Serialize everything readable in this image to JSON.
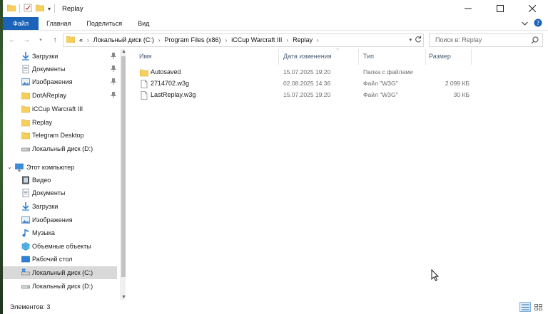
{
  "window": {
    "title": "Replay"
  },
  "ribbon": {
    "tabs": [
      "Файл",
      "Главная",
      "Поделиться",
      "Вид"
    ]
  },
  "address": {
    "overflow": "«",
    "crumbs": [
      "Локальный диск (C:)",
      "Program Files (x86)",
      "iCCup Warcraft III",
      "Replay"
    ]
  },
  "search": {
    "placeholder": "Поиск в: Replay"
  },
  "sidebar": {
    "quick_access": [
      {
        "label": "Загрузки",
        "icon": "downloads-icon",
        "pinned": true
      },
      {
        "label": "Документы",
        "icon": "documents-icon",
        "pinned": true
      },
      {
        "label": "Изображения",
        "icon": "pictures-icon",
        "pinned": true
      },
      {
        "label": "DotAReplay",
        "icon": "folder-icon",
        "pinned": true
      },
      {
        "label": "iCCup Warcraft III",
        "icon": "folder-icon",
        "pinned": false
      },
      {
        "label": "Replay",
        "icon": "folder-icon",
        "pinned": false
      },
      {
        "label": "Telegram Desktop",
        "icon": "folder-icon",
        "pinned": false
      },
      {
        "label": "Локальный диск (D:)",
        "icon": "drive-icon",
        "pinned": false
      }
    ],
    "this_pc": {
      "label": "Этот компьютер",
      "items": [
        {
          "label": "Видео",
          "icon": "video-icon"
        },
        {
          "label": "Документы",
          "icon": "documents-icon"
        },
        {
          "label": "Загрузки",
          "icon": "downloads-icon"
        },
        {
          "label": "Изображения",
          "icon": "pictures-icon"
        },
        {
          "label": "Музыка",
          "icon": "music-icon"
        },
        {
          "label": "Объемные объекты",
          "icon": "3d-objects-icon"
        },
        {
          "label": "Рабочий стол",
          "icon": "desktop-icon"
        },
        {
          "label": "Локальный диск (C:)",
          "icon": "system-drive-icon",
          "selected": true
        },
        {
          "label": "Локальный диск (D:)",
          "icon": "drive-icon"
        }
      ]
    }
  },
  "columns": {
    "name": "Имя",
    "date": "Дата изменения",
    "type": "Тип",
    "size": "Размер"
  },
  "files": [
    {
      "name": "Autosaved",
      "date": "15.07.2025 19:20",
      "type": "Папка с файлами",
      "size": "",
      "icon": "folder-icon"
    },
    {
      "name": "2714702.w3g",
      "date": "02.08.2025 14:36",
      "type": "Файл \"W3G\"",
      "size": "2 099 КБ",
      "icon": "file-icon"
    },
    {
      "name": "LastReplay.w3g",
      "date": "15.07.2025 19:20",
      "type": "Файл \"W3G\"",
      "size": "30 КБ",
      "icon": "file-icon"
    }
  ],
  "status": {
    "items_count": "Элементов: 3"
  },
  "colors": {
    "file_tab": "#1a63b8",
    "folder": "#f6cf5c",
    "selection": "#d9d9d9"
  }
}
